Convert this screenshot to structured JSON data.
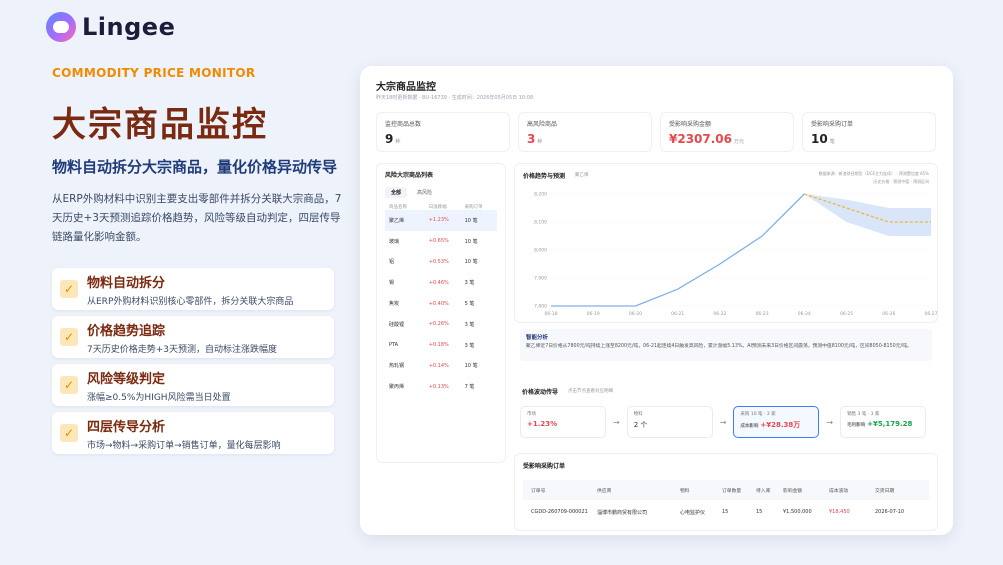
{
  "brand": {
    "name": "Lingee",
    "icon": "lingee-logo-icon"
  },
  "hero": {
    "eyebrow": "COMMODITY PRICE MONITOR",
    "title": "大宗商品监控",
    "subtitle": "物料自动拆分大宗商品，量化价格异动传导",
    "description": "从ERP外购材料中识别主要支出零部件并拆分关联大宗商品，7天历史+3天预测追踪价格趋势，风险等级自动判定，四层传导链路量化影响金额。"
  },
  "features": [
    {
      "title": "物料自动拆分",
      "desc": "从ERP外购材料识别核心零部件，拆分关联大宗商品"
    },
    {
      "title": "价格趋势追踪",
      "desc": "7天历史价格走势+3天预测，自动标注涨跌幅度"
    },
    {
      "title": "风险等级判定",
      "desc": "涨幅≥0.5%为HIGH风险需当日处置"
    },
    {
      "title": "四层传导分析",
      "desc": "市场→物料→采购订单→销售订单，量化每层影响"
    }
  ],
  "panel": {
    "title": "大宗商品监控",
    "meta": "昨天18时更新数据 · BU-16739 · 生成时间：2026年05月05日 10:08",
    "stats": [
      {
        "label": "监控商品总数",
        "value": "9",
        "unit": "种",
        "color": "normal"
      },
      {
        "label": "高风险商品",
        "value": "3",
        "unit": "种",
        "color": "red"
      },
      {
        "label": "受影响采购金额",
        "value": "¥2307.06",
        "unit": "万元",
        "color": "red"
      },
      {
        "label": "受影响采购订单",
        "value": "10",
        "unit": "笔",
        "color": "normal"
      }
    ],
    "risk_list": {
      "title": "风险大宗商品列表",
      "tabs": [
        "全部",
        "高风险"
      ],
      "headers": [
        "商品名称",
        "日涨跌幅",
        "采购订单"
      ],
      "rows": [
        {
          "name": "聚乙烯",
          "pct": "+1.23%",
          "orders": "10 笔"
        },
        {
          "name": "玻璃",
          "pct": "+0.65%",
          "orders": "10 笔"
        },
        {
          "name": "铝",
          "pct": "+0.53%",
          "orders": "10 笔"
        },
        {
          "name": "锡",
          "pct": "+0.46%",
          "orders": "3 笔"
        },
        {
          "name": "焦炭",
          "pct": "+0.40%",
          "orders": "5 笔"
        },
        {
          "name": "硅酸锂",
          "pct": "+0.26%",
          "orders": "3 笔"
        },
        {
          "name": "PTA",
          "pct": "+0.18%",
          "orders": "3 笔"
        },
        {
          "name": "热轧钢",
          "pct": "+0.14%",
          "orders": "10 笔"
        },
        {
          "name": "聚丙烯",
          "pct": "+0.13%",
          "orders": "7 笔"
        }
      ]
    },
    "chart": {
      "title": "价格趋势与预测",
      "subtitle": "聚乙烯",
      "notes": "数据来源：新浪财经期货（DCE主力连续） · 预测置信度 85%",
      "legend": [
        "历史价格",
        "预测中值",
        "预测区间"
      ]
    },
    "ai": {
      "title": "智能分析",
      "text": "聚乙烯近7日价格从7800元/吨持续上涨至8200元/吨，06-21起连续4日触发高风险，累计涨幅5.13%。AI预测未来3日价格区间震荡，预测中值8100元/吨，区间8050-8150元/吨。"
    },
    "propagation": {
      "title": "价格波动传导",
      "subtitle": "点击节点查看对应明细",
      "nodes": [
        {
          "label": "市场",
          "value": "+1.23%",
          "tone": "red"
        },
        {
          "label": "物料",
          "value": "2 个",
          "tone": "normal"
        },
        {
          "label": "采购",
          "sub": "10 笔 · 3 家",
          "label2": "成本影响",
          "value": "+¥28.38万",
          "tone": "red"
        },
        {
          "label": "销售",
          "sub": "3 笔 · 3 家",
          "label2": "毛利影响",
          "value": "+¥5,179.28",
          "tone": "green"
        }
      ]
    },
    "orders": {
      "title": "受影响采购订单",
      "headers": [
        "订单号",
        "供应商",
        "物料",
        "订单数量",
        "待入库",
        "影响金额",
        "成本波动",
        "交货日期"
      ],
      "rows": [
        [
          "CGDD-260709-000021",
          "淄博市鹏商贸有限公司",
          "心电监护仪",
          "15",
          "15",
          "¥1,500,000",
          "¥18,450",
          "2026-07-10"
        ]
      ]
    }
  },
  "chart_data": {
    "type": "line",
    "title": "价格趋势与预测",
    "x": [
      "06-18",
      "06-19",
      "06-20",
      "06-21",
      "06-22",
      "06-23",
      "06-24",
      "06-25",
      "06-26",
      "06-27"
    ],
    "ylim": [
      7800,
      8200
    ],
    "yticks": [
      7800,
      7900,
      8000,
      8100,
      8200
    ],
    "series": [
      {
        "name": "历史价格",
        "values": [
          7800,
          7800,
          7800,
          7860,
          7950,
          8050,
          8200,
          null,
          null,
          null
        ]
      },
      {
        "name": "预测中值",
        "values": [
          null,
          null,
          null,
          null,
          null,
          null,
          8200,
          8150,
          8100,
          8100
        ]
      }
    ],
    "band": {
      "name": "预测区间",
      "x": [
        "06-24",
        "06-25",
        "06-26",
        "06-27"
      ],
      "low": [
        8200,
        8100,
        8050,
        8050
      ],
      "high": [
        8200,
        8180,
        8150,
        8150
      ]
    },
    "colors": {
      "history": "#7fb0e8",
      "forecast": "#f3b23b",
      "band": "#cfe0f7"
    }
  }
}
